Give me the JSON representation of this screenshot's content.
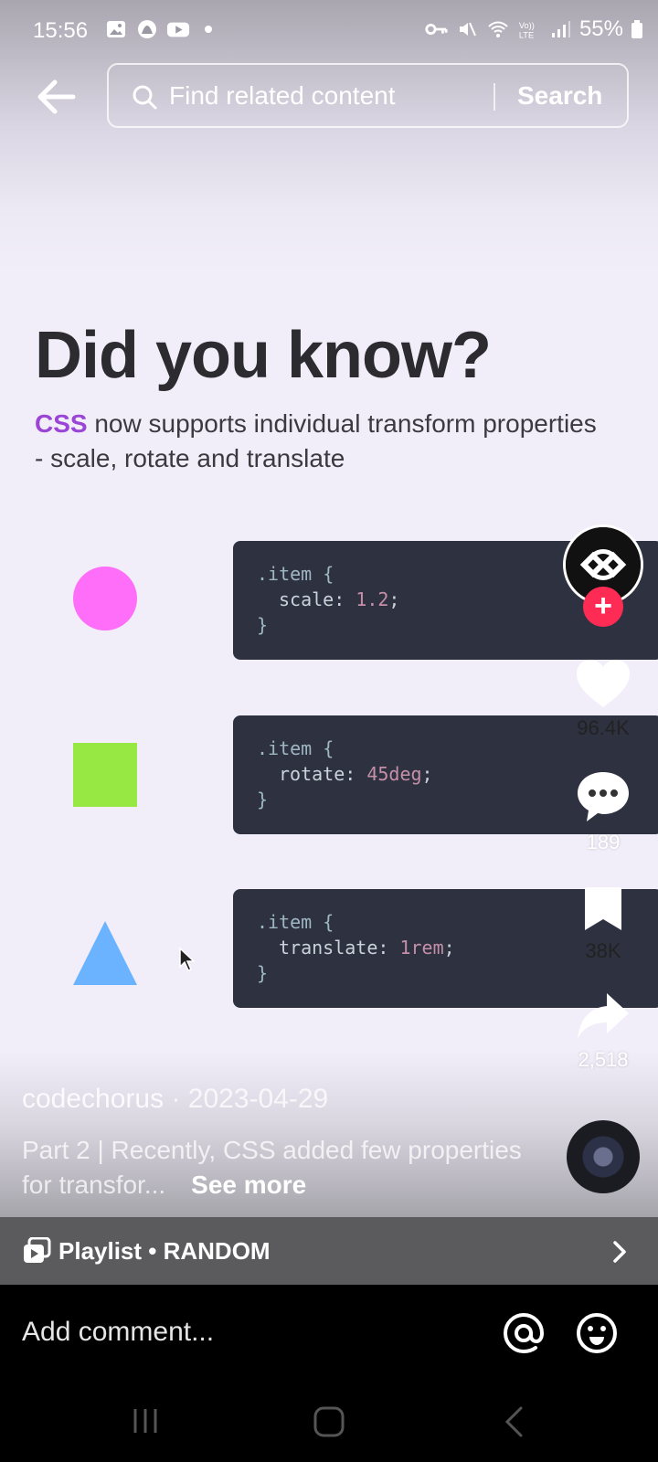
{
  "status_bar": {
    "time": "15:56",
    "battery": "55%",
    "icons": [
      "gallery-icon",
      "app-icon",
      "youtube-icon",
      "notification-dot",
      "key-icon",
      "mute-icon",
      "wifi-icon",
      "volte-icon",
      "signal-icon",
      "battery-icon"
    ]
  },
  "top_bar": {
    "search_placeholder": "Find related content",
    "search_label": "Search"
  },
  "video": {
    "headline": "Did you know?",
    "sub_accent": "CSS",
    "sub_text": " now supports individual transform properties - scale, rotate and translate",
    "cards": [
      {
        "selector": ".item {",
        "prop": "scale: ",
        "value": "1.2",
        "end": ";",
        "close": "}",
        "shape_color": "#ff6ef8"
      },
      {
        "selector": ".item {",
        "prop": "rotate: ",
        "value": "45deg",
        "end": ";",
        "close": "}",
        "shape_color": "#97e843"
      },
      {
        "selector": ".item {",
        "prop": "translate: ",
        "value": "1rem",
        "end": ";",
        "close": "}",
        "shape_color": "#6cb3ff"
      }
    ]
  },
  "rail": {
    "likes": "96.4K",
    "comments": "189",
    "bookmarks": "38K",
    "shares": "2,518",
    "follow_symbol": "+"
  },
  "caption": {
    "author": "codechorus",
    "date": " · 2023-04-29",
    "text": "Part 2 | Recently, CSS added few properties for transfor...",
    "see_more": "See more"
  },
  "playlist": {
    "label": "Playlist • RANDOM"
  },
  "comment_bar": {
    "placeholder": "Add comment..."
  },
  "colors": {
    "accent": "#9a45d6",
    "follow": "#fe2c55",
    "code_bg": "#2d3140"
  }
}
